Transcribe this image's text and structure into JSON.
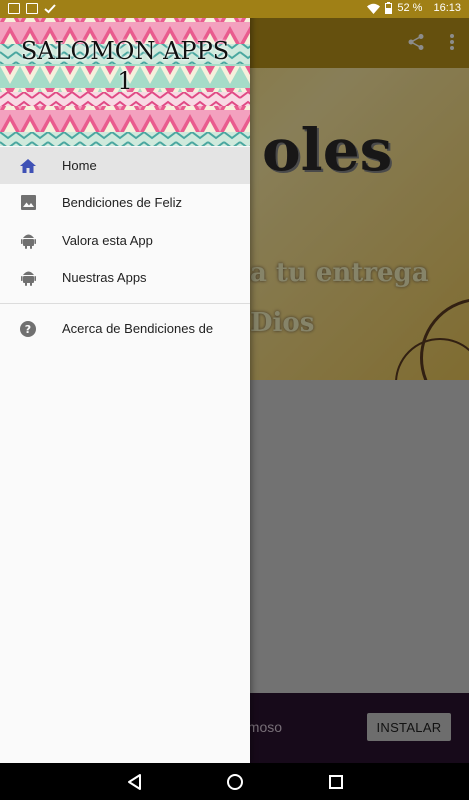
{
  "status_bar": {
    "battery": "52 %",
    "time": "16:13",
    "icons": [
      "gmail-icon",
      "image-icon",
      "check-icon",
      "wifi-icon",
      "battery-icon"
    ]
  },
  "app_bar": {
    "icons": [
      "share-icon",
      "more-vert-icon"
    ]
  },
  "hero": {
    "text_line1": "oles",
    "text_line2": "a tu entrega",
    "text_line3": "Dios"
  },
  "ad": {
    "text": "amoso",
    "install_label": "INSTALAR"
  },
  "drawer": {
    "header_title_line1": "SALOMON APPS",
    "header_title_line2": "1",
    "items": [
      {
        "label": "Home",
        "icon": "home-icon",
        "active": true
      },
      {
        "label": "Bendiciones de Feliz",
        "icon": "image-icon"
      },
      {
        "label": "Valora esta App",
        "icon": "android-icon"
      },
      {
        "label": "Nuestras Apps",
        "icon": "android-icon"
      },
      {
        "label": "Acerca de Bendiciones de",
        "icon": "help-icon"
      }
    ]
  },
  "colors": {
    "app_bar": "#b8921a",
    "active_icon": "#3f51b5",
    "ad_background": "#2b1330"
  }
}
